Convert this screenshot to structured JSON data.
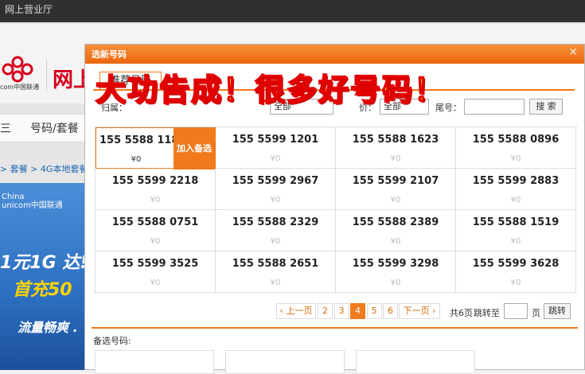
{
  "app": {
    "title": "网上营业厅"
  },
  "background": {
    "brand_text": "com中国联通",
    "site_title": "网上",
    "nav_item_1": "三",
    "nav_item_2": "号码/套餐",
    "breadcrumb": "> 套餐  >  4G本地套餐 >",
    "banner_logo": "China\nunicom中国联通",
    "banner_line1": "1元1G 达!",
    "banner_line2": "首充50",
    "banner_line3": "流量畅爽 ."
  },
  "overlay_text": "大功告成！很多好号码！",
  "modal": {
    "title": "选新号码",
    "close_label": "✕",
    "tab_label": "推荐号码",
    "filters": {
      "label_1": "归属：",
      "label_2": "别：",
      "select_2": "全部",
      "label_3": "价：",
      "select_3": "全部",
      "label_4": "尾号：",
      "select_4": "",
      "search_label": "搜 索"
    },
    "numbers": [
      {
        "number": "155 5588 1187",
        "price": "¥0",
        "selected": true
      },
      {
        "number": "155  5599 1201",
        "price": "¥0"
      },
      {
        "number": "155  5588  1623",
        "price": "¥0"
      },
      {
        "number": "155  5588  0896",
        "price": "¥0"
      },
      {
        "number": "155  5599  2218",
        "price": "¥0"
      },
      {
        "number": "155  5599 2967",
        "price": "¥0"
      },
      {
        "number": "155  5599  2107",
        "price": "¥0"
      },
      {
        "number": "155  5599  2883",
        "price": "¥0"
      },
      {
        "number": "155  5588  0751",
        "price": "¥0"
      },
      {
        "number": "155  5588  2329",
        "price": "¥0"
      },
      {
        "number": "155  5588  2389",
        "price": "¥0"
      },
      {
        "number": "155  5588  1519",
        "price": "¥0"
      },
      {
        "number": "155  5599  3525",
        "price": "¥0"
      },
      {
        "number": "155  5588 2651",
        "price": "¥0"
      },
      {
        "number": "155  5599  3298",
        "price": "¥0"
      },
      {
        "number": "155  5599  3628",
        "price": "¥0"
      }
    ],
    "add_button": "加入备选",
    "pager": {
      "prev": "‹ 上一页",
      "pages": [
        "2",
        "3",
        "4",
        "5",
        "6"
      ],
      "current": "4",
      "next": "下一页 ›",
      "total": "共6页",
      "jump_label": "跳转至",
      "page_unit": "页",
      "go_label": "跳转"
    },
    "candidates_label": "备选号码:"
  }
}
